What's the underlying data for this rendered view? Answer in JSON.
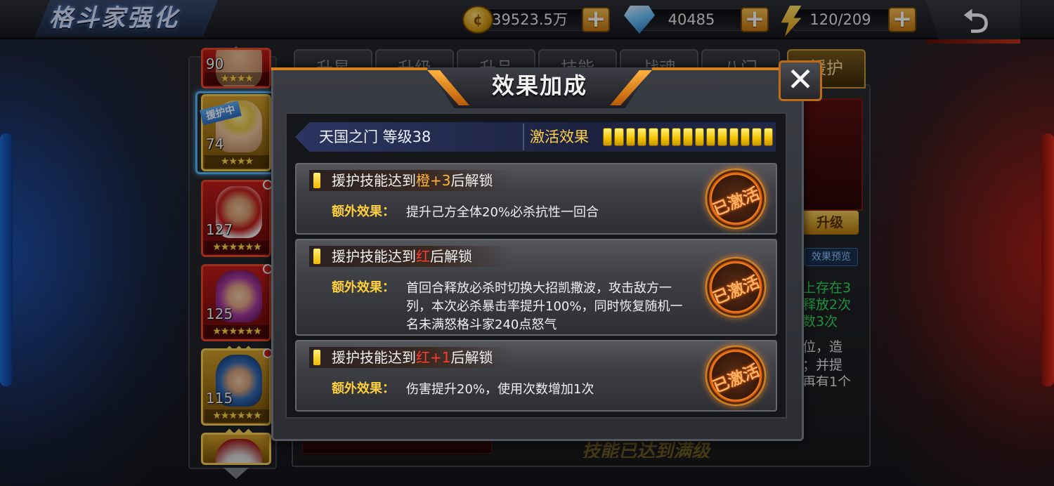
{
  "header": {
    "title": "格斗家强化",
    "gold": "39523.5万",
    "diamonds": "40485",
    "stamina": "120/209",
    "plus_label": "+",
    "back_icon": "back-arrow-icon"
  },
  "underlying": {
    "tabs": [
      "升星",
      "升级",
      "升品",
      "技能",
      "战魂",
      "八门",
      "援护"
    ],
    "active_tab": "援护",
    "upgrade_label": "升级",
    "preview_label": "效果预览",
    "desc_lines": [
      "上存在3",
      "释放2次",
      "数3次",
      "位，造",
      "；并提",
      "再有1个"
    ],
    "bottom_text": "技能已达到满级"
  },
  "roster": {
    "heroes": [
      {
        "level": "90",
        "stars": "★★★★"
      },
      {
        "level": "74",
        "stars": "★★★★",
        "tag": "援护中"
      },
      {
        "level": "127",
        "stars": "★★★★★★"
      },
      {
        "level": "125",
        "stars": "★★★★★★"
      },
      {
        "level": "115",
        "stars": "★★★★★★"
      },
      {
        "level": "",
        "stars": ""
      }
    ],
    "diamonds": "◆◆◆"
  },
  "modal": {
    "title": "效果加成",
    "close_label": "✕",
    "skill_name": "天国之门 等级38",
    "activate_label": "激活效果",
    "activate_segments": 15,
    "extra_label": "额外效果：",
    "effects": [
      {
        "cond_prefix": "援护技能达到",
        "cond_highlight": "橙+3",
        "cond_suffix": "后解锁",
        "extra": "提升己方全体20%必杀抗性一回合",
        "status": "已激活"
      },
      {
        "cond_prefix": "援护技能达到",
        "cond_highlight": "红",
        "cond_suffix": "后解锁",
        "extra": "首回合释放必杀时切换大招凯撒波，攻击敌方一列，本次必杀暴击率提升100%，同时恢复随机一名未满怒格斗家240点怒气",
        "status": "已激活"
      },
      {
        "cond_prefix": "援护技能达到",
        "cond_highlight": "红+1",
        "cond_suffix": "后解锁",
        "extra": "伤害提升20%，使用次数增加1次",
        "status": "已激活"
      }
    ]
  }
}
